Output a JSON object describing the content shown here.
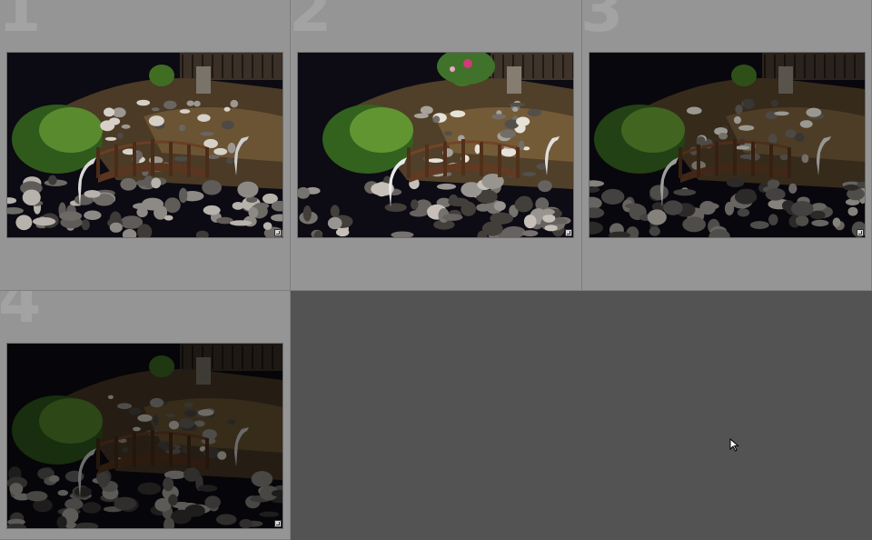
{
  "grid": {
    "cells": [
      {
        "index": "1",
        "brightness": "normal"
      },
      {
        "index": "2",
        "brightness": "bright"
      },
      {
        "index": "3",
        "brightness": "darker"
      },
      {
        "index": "4",
        "brightness": "darkest"
      }
    ]
  },
  "colors": {
    "cell_bg": "#959595",
    "empty_bg": "#535353",
    "index_color": "#a3a3a3"
  },
  "icons": {
    "badge": "edit-badge-icon",
    "cursor": "mouse-pointer-icon"
  }
}
